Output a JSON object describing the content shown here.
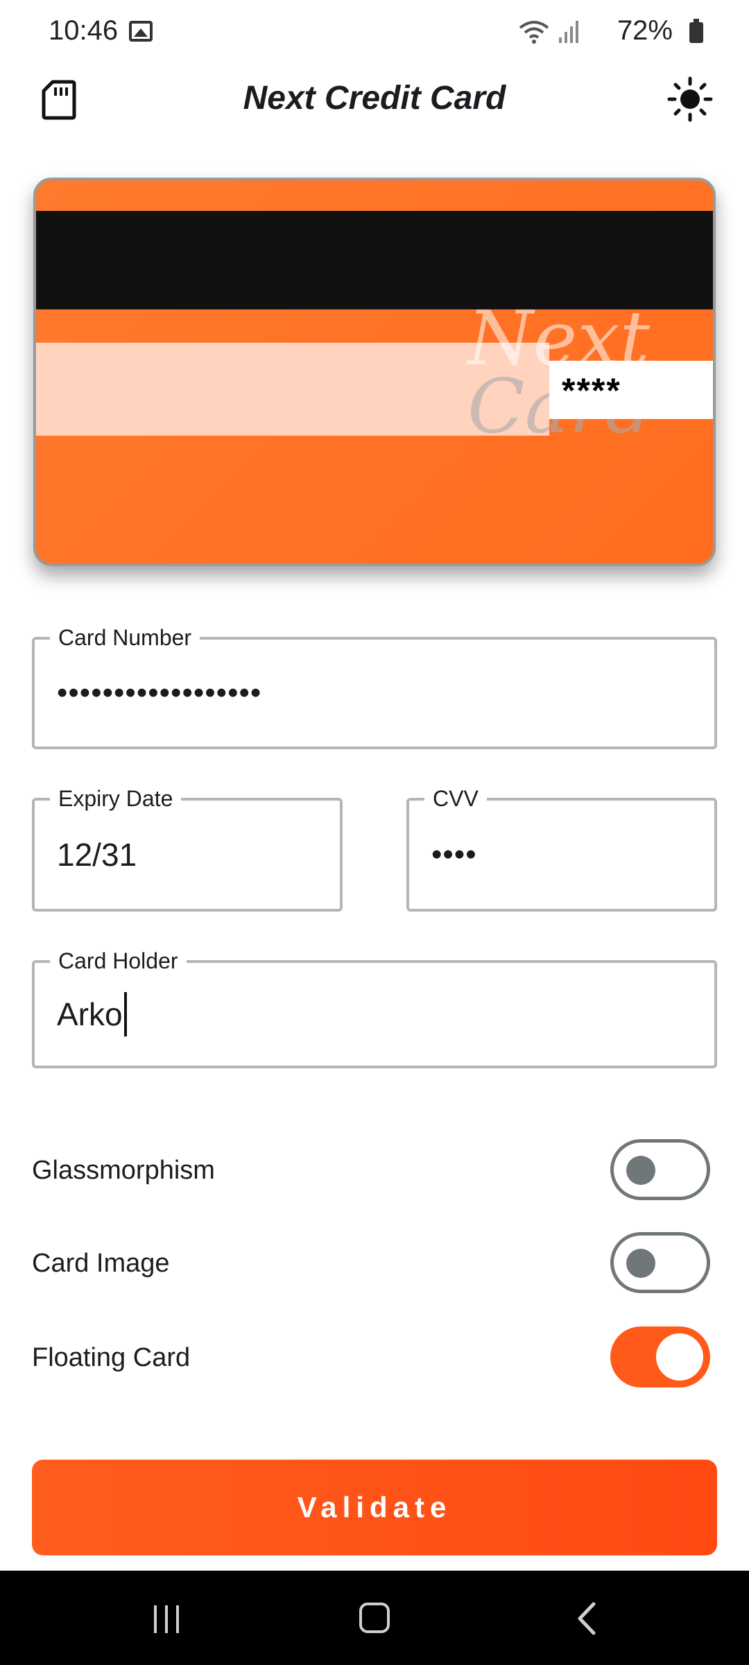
{
  "status_bar": {
    "time": "10:46",
    "battery": "72%"
  },
  "app_bar": {
    "title": "Next Credit Card"
  },
  "card_preview": {
    "watermark_line1": "Next",
    "watermark_line2": "Card",
    "cvv_masked": "****",
    "color": "#ff7329"
  },
  "form": {
    "card_number": {
      "label": "Card Number",
      "value": "••••••••••••••••••"
    },
    "expiry_date": {
      "label": "Expiry Date",
      "value": "12/31"
    },
    "cvv": {
      "label": "CVV",
      "value": "••••"
    },
    "card_holder": {
      "label": "Card Holder",
      "value": "Arko"
    }
  },
  "toggles": [
    {
      "label": "Glassmorphism",
      "on": false
    },
    {
      "label": "Card Image",
      "on": false
    },
    {
      "label": "Floating Card",
      "on": true
    }
  ],
  "validate_button": {
    "label": "Validate"
  },
  "colors": {
    "accent": "#ff5a1a",
    "switch_off": "#6f7778",
    "field_border": "#b5b5b5"
  },
  "icons": {
    "app_bar_left": "sd-card-icon",
    "app_bar_right": "brightness-icon"
  }
}
